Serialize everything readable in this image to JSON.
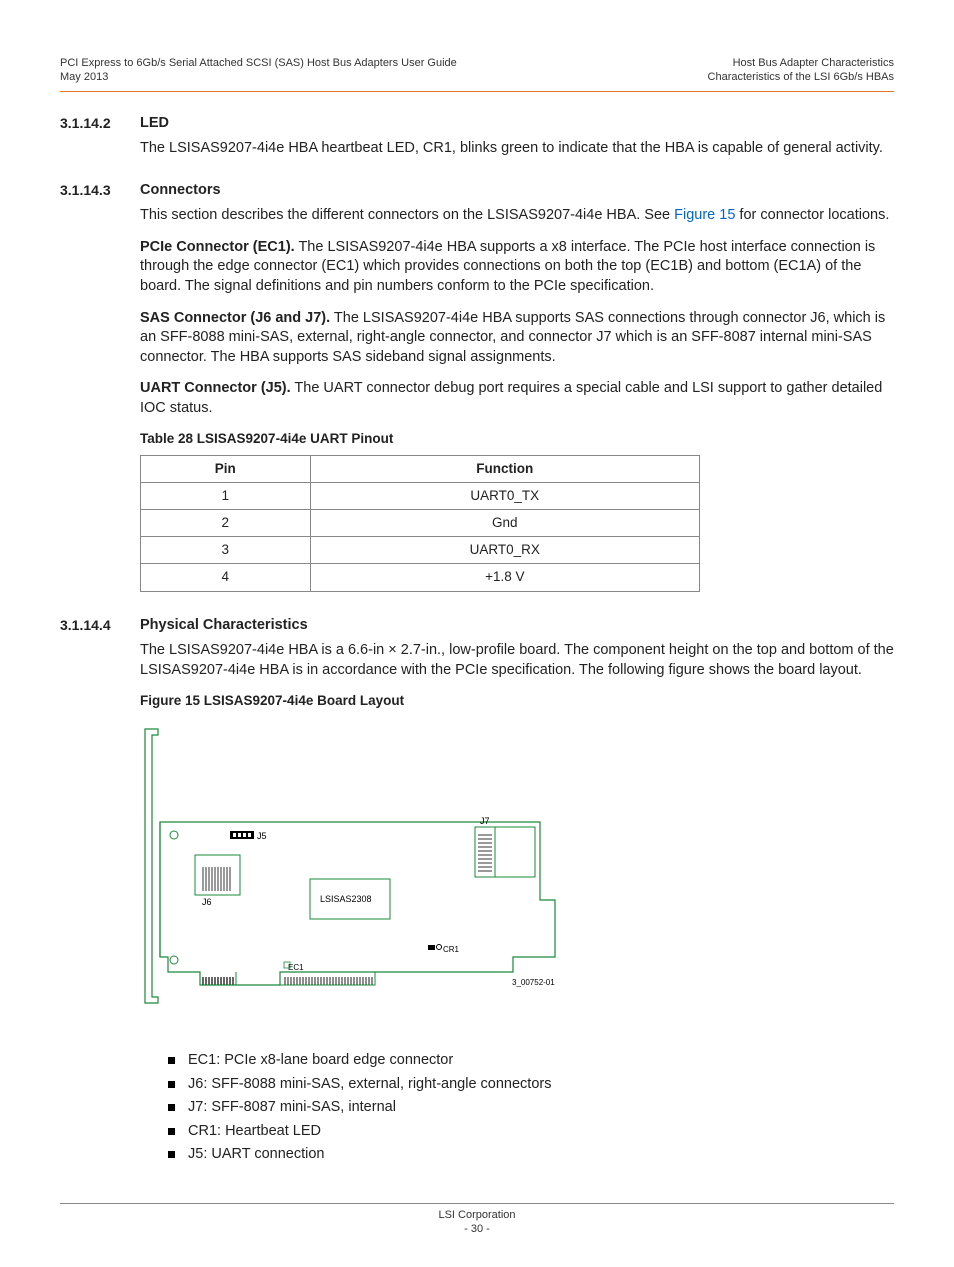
{
  "header": {
    "left1": "PCI Express to 6Gb/s Serial Attached SCSI (SAS) Host Bus Adapters User Guide",
    "left2": "May 2013",
    "right1": "Host Bus Adapter Characteristics",
    "right2": "Characteristics of the LSI 6Gb/s HBAs"
  },
  "s1": {
    "num": "3.1.14.2",
    "title": "LED",
    "body": "The LSISAS9207-4i4e HBA heartbeat LED, CR1, blinks green to indicate that the HBA is capable of general activity."
  },
  "s2": {
    "num": "3.1.14.3",
    "title": "Connectors",
    "intro1": "This section describes the different connectors on the LSISAS9207-4i4e HBA. See ",
    "figlink": "Figure 15",
    "intro2": " for connector locations.",
    "pcie_bold": "PCIe Connector (EC1).",
    "pcie_body": " The LSISAS9207-4i4e HBA supports a x8 interface. The PCIe host interface connection is through the edge connector (EC1) which provides connections on both the top (EC1B) and bottom (EC1A) of the board. The signal definitions and pin numbers conform to the PCIe specification.",
    "sas_bold": "SAS Connector (J6 and J7).",
    "sas_body": " The LSISAS9207-4i4e HBA supports SAS connections through connector J6, which is an SFF-8088 mini-SAS, external, right-angle connector, and connector J7 which is an SFF-8087 internal mini-SAS connector. The HBA supports SAS sideband signal assignments.",
    "uart_bold": "UART Connector (J5).",
    "uart_body": " The UART connector debug port requires a special cable and LSI support to gather detailed IOC status."
  },
  "table": {
    "caption": "Table 28  LSISAS9207-4i4e UART Pinout",
    "h1": "Pin",
    "h2": "Function",
    "rows": [
      {
        "pin": "1",
        "fn": "UART0_TX"
      },
      {
        "pin": "2",
        "fn": "Gnd"
      },
      {
        "pin": "3",
        "fn": "UART0_RX"
      },
      {
        "pin": "4",
        "fn": "+1.8 V"
      }
    ]
  },
  "s3": {
    "num": "3.1.14.4",
    "title": "Physical Characteristics",
    "body": "The LSISAS9207-4i4e HBA is a 6.6-in × 2.7-in., low-profile board. The component height on the top and bottom of the LSISAS9207-4i4e HBA is in accordance with the PCIe specification. The following figure shows the board layout."
  },
  "figure": {
    "caption": "Figure 15  LSISAS9207-4i4e Board Layout",
    "labels": {
      "j5": "J5",
      "j6": "J6",
      "j7": "J7",
      "chip": "LSISAS2308",
      "cr1": "CR1",
      "ec1": "EC1",
      "partno": "3_00752-01"
    }
  },
  "bullets": {
    "b0": "EC1: PCIe x8-lane board edge connector",
    "b1": "J6: SFF-8088 mini-SAS, external, right-angle connectors",
    "b2": "J7: SFF-8087 mini-SAS, internal",
    "b3": "CR1: Heartbeat LED",
    "b4": "J5: UART connection"
  },
  "footer": {
    "corp": "LSI Corporation",
    "page": "- 30 -"
  }
}
